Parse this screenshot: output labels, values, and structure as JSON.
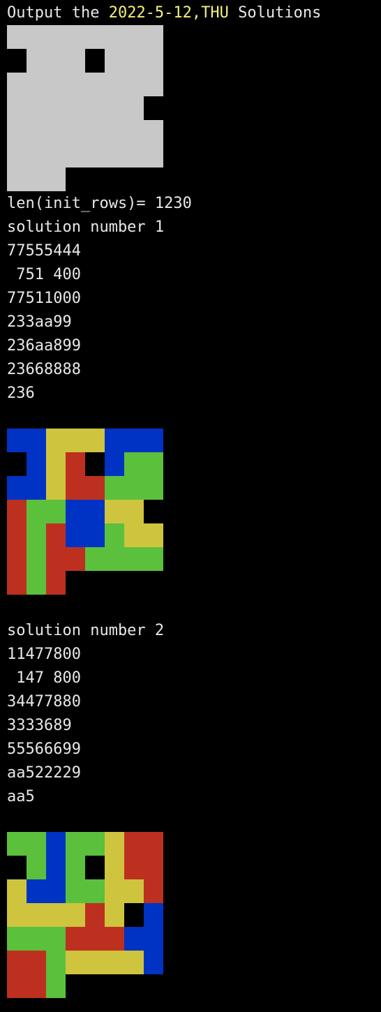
{
  "header": {
    "prefix": "Output the ",
    "date": "2022-5-12,THU",
    "suffix": " Solutions"
  },
  "colors": {
    "0": "#000000",
    "1": "#c8c8c8",
    "B": "#0033c4",
    "Y": "#cec43e",
    "R": "#bd3020",
    "G": "#5bc03c"
  },
  "board_grid": [
    "11111111",
    "01110111",
    "11111111",
    "11111110",
    "11111111",
    "11111111",
    "111"
  ],
  "init_rows_line": "len(init_rows)= 1230",
  "solutions": [
    {
      "title": "solution number 1",
      "rows": [
        "77555444",
        " 751 400",
        "77511000",
        "233aa99",
        "236aa899",
        "23668888",
        "236"
      ],
      "grid": [
        "BBYYYBBB",
        "0BYR0BGG",
        "BBYRRGGG",
        "RGGBBYY0",
        "RGRBBGYY",
        "RGRRGGGG",
        "RGR"
      ]
    },
    {
      "title": "solution number 2",
      "rows": [
        "11477800",
        " 147 800",
        "34477880",
        "3333689",
        "55566699",
        "aa522229",
        "aa5"
      ],
      "grid": [
        "GGBGGYRR",
        "0GBG0YRR",
        "YBBGGYYR",
        "YYYYRY B",
        "GGGRRRBB",
        "RRGYYYYB",
        "RRG"
      ]
    }
  ]
}
